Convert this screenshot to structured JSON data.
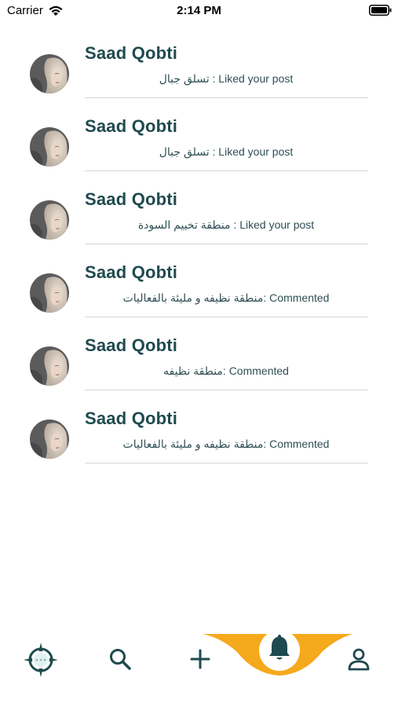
{
  "status_bar": {
    "carrier": "Carrier",
    "time": "2:14 PM"
  },
  "notifications": [
    {
      "name": "Saad Qobti",
      "detail": "تسلق جبال : Liked your post"
    },
    {
      "name": "Saad Qobti",
      "detail": "تسلق جبال : Liked your post"
    },
    {
      "name": "Saad Qobti",
      "detail": "منطقة تخييم السودة : Liked your post"
    },
    {
      "name": "Saad Qobti",
      "detail": "منطقة نظيفه و مليئة بالفعاليات: Commented"
    },
    {
      "name": "Saad Qobti",
      "detail": "منطقة نظيفه: Commented"
    },
    {
      "name": "Saad Qobti",
      "detail": "منطقة نظيفه و مليئة بالفعاليات: Commented"
    }
  ],
  "tab_bar": {
    "items": [
      "compass-icon",
      "search-icon",
      "add-icon",
      "bell-icon",
      "profile-icon"
    ],
    "active": "bell-icon",
    "accent_color": "#F5A91C",
    "icon_color": "#1F4A4F"
  },
  "colors": {
    "name_text": "#1F4A4F",
    "detail_text": "#2F4F54",
    "divider": "#D6D6D6"
  }
}
